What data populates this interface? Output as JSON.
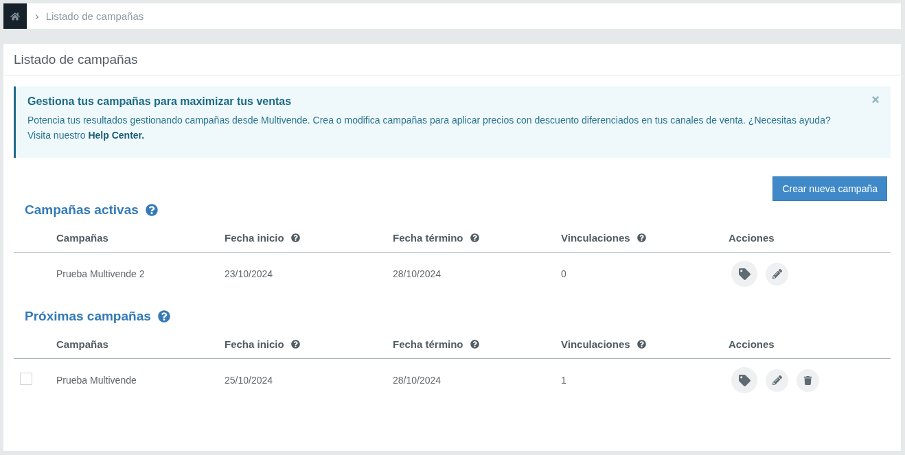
{
  "breadcrumb": {
    "separator": "›",
    "items": [
      "Listado de campañas"
    ]
  },
  "page": {
    "title": "Listado de campañas"
  },
  "alert": {
    "title": "Gestiona tus campañas para maximizar tus ventas",
    "text": "Potencia tus resultados gestionando campañas desde Multivende. Crea o modifica campañas para aplicar precios con descuento diferenciados en tus canales de venta. ¿Necesitas ayuda? Visita nuestro ",
    "link": "Help Center.",
    "close": "×"
  },
  "create_button": "Crear nueva campaña",
  "sections": [
    {
      "title": "Campañas activas",
      "columns": [
        {
          "label": "Campañas",
          "help": false
        },
        {
          "label": "Fecha inicio",
          "help": true
        },
        {
          "label": "Fecha término",
          "help": true
        },
        {
          "label": "Vinculaciones",
          "help": true
        },
        {
          "label": "Acciones",
          "help": false
        }
      ],
      "rows": [
        {
          "name": "Prueba Multivende 2",
          "start": "23/10/2024",
          "end": "28/10/2024",
          "links": "0",
          "actions": [
            {
              "kind": "tag"
            },
            {
              "kind": "edit"
            }
          ]
        }
      ]
    },
    {
      "title": "Próximas campañas",
      "columns": [
        {
          "label": "Campañas",
          "help": false
        },
        {
          "label": "Fecha inicio",
          "help": true
        },
        {
          "label": "Fecha término",
          "help": true
        },
        {
          "label": "Vinculaciones",
          "help": true
        },
        {
          "label": "Acciones",
          "help": false
        }
      ],
      "rows": [
        {
          "checked": false,
          "name": "Prueba Multivende",
          "start": "25/10/2024",
          "end": "28/10/2024",
          "links": "1",
          "actions": [
            {
              "kind": "tag"
            },
            {
              "kind": "edit"
            },
            {
              "kind": "delete"
            }
          ]
        }
      ]
    }
  ]
}
